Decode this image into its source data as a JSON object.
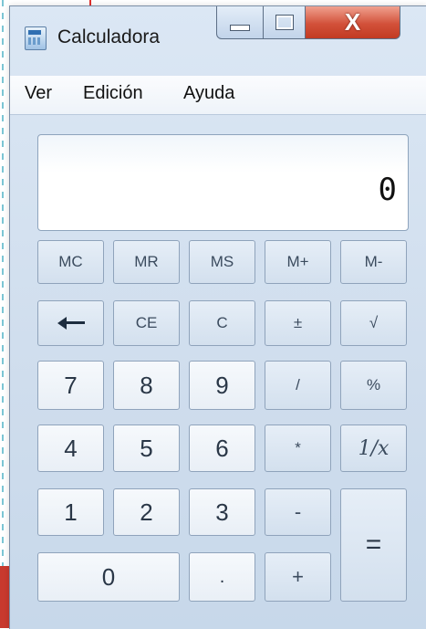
{
  "window": {
    "title": "Calculadora"
  },
  "menu": {
    "items": [
      "Ver",
      "Edición",
      "Ayuda"
    ]
  },
  "display": {
    "value": "0"
  },
  "keys": {
    "mc": "MC",
    "mr": "MR",
    "ms": "MS",
    "mplus": "M+",
    "mminus": "M-",
    "ce": "CE",
    "c": "C",
    "plusminus": "±",
    "sqrt": "√",
    "seven": "7",
    "eight": "8",
    "nine": "9",
    "divide": "/",
    "percent": "%",
    "four": "4",
    "five": "5",
    "six": "6",
    "multiply": "*",
    "reciprocal": "1/x",
    "one": "1",
    "two": "2",
    "three": "3",
    "minus": "-",
    "zero": "0",
    "decimal": ".",
    "plus": "+",
    "equals": "="
  },
  "icons": {
    "app": "calculator-icon",
    "backspace": "backspace-arrow-icon",
    "minimize": "minimize-icon",
    "maximize": "maximize-icon",
    "close": "close-icon"
  },
  "colors": {
    "close_button": "#d2513a",
    "window_frame": "#cfdded"
  }
}
